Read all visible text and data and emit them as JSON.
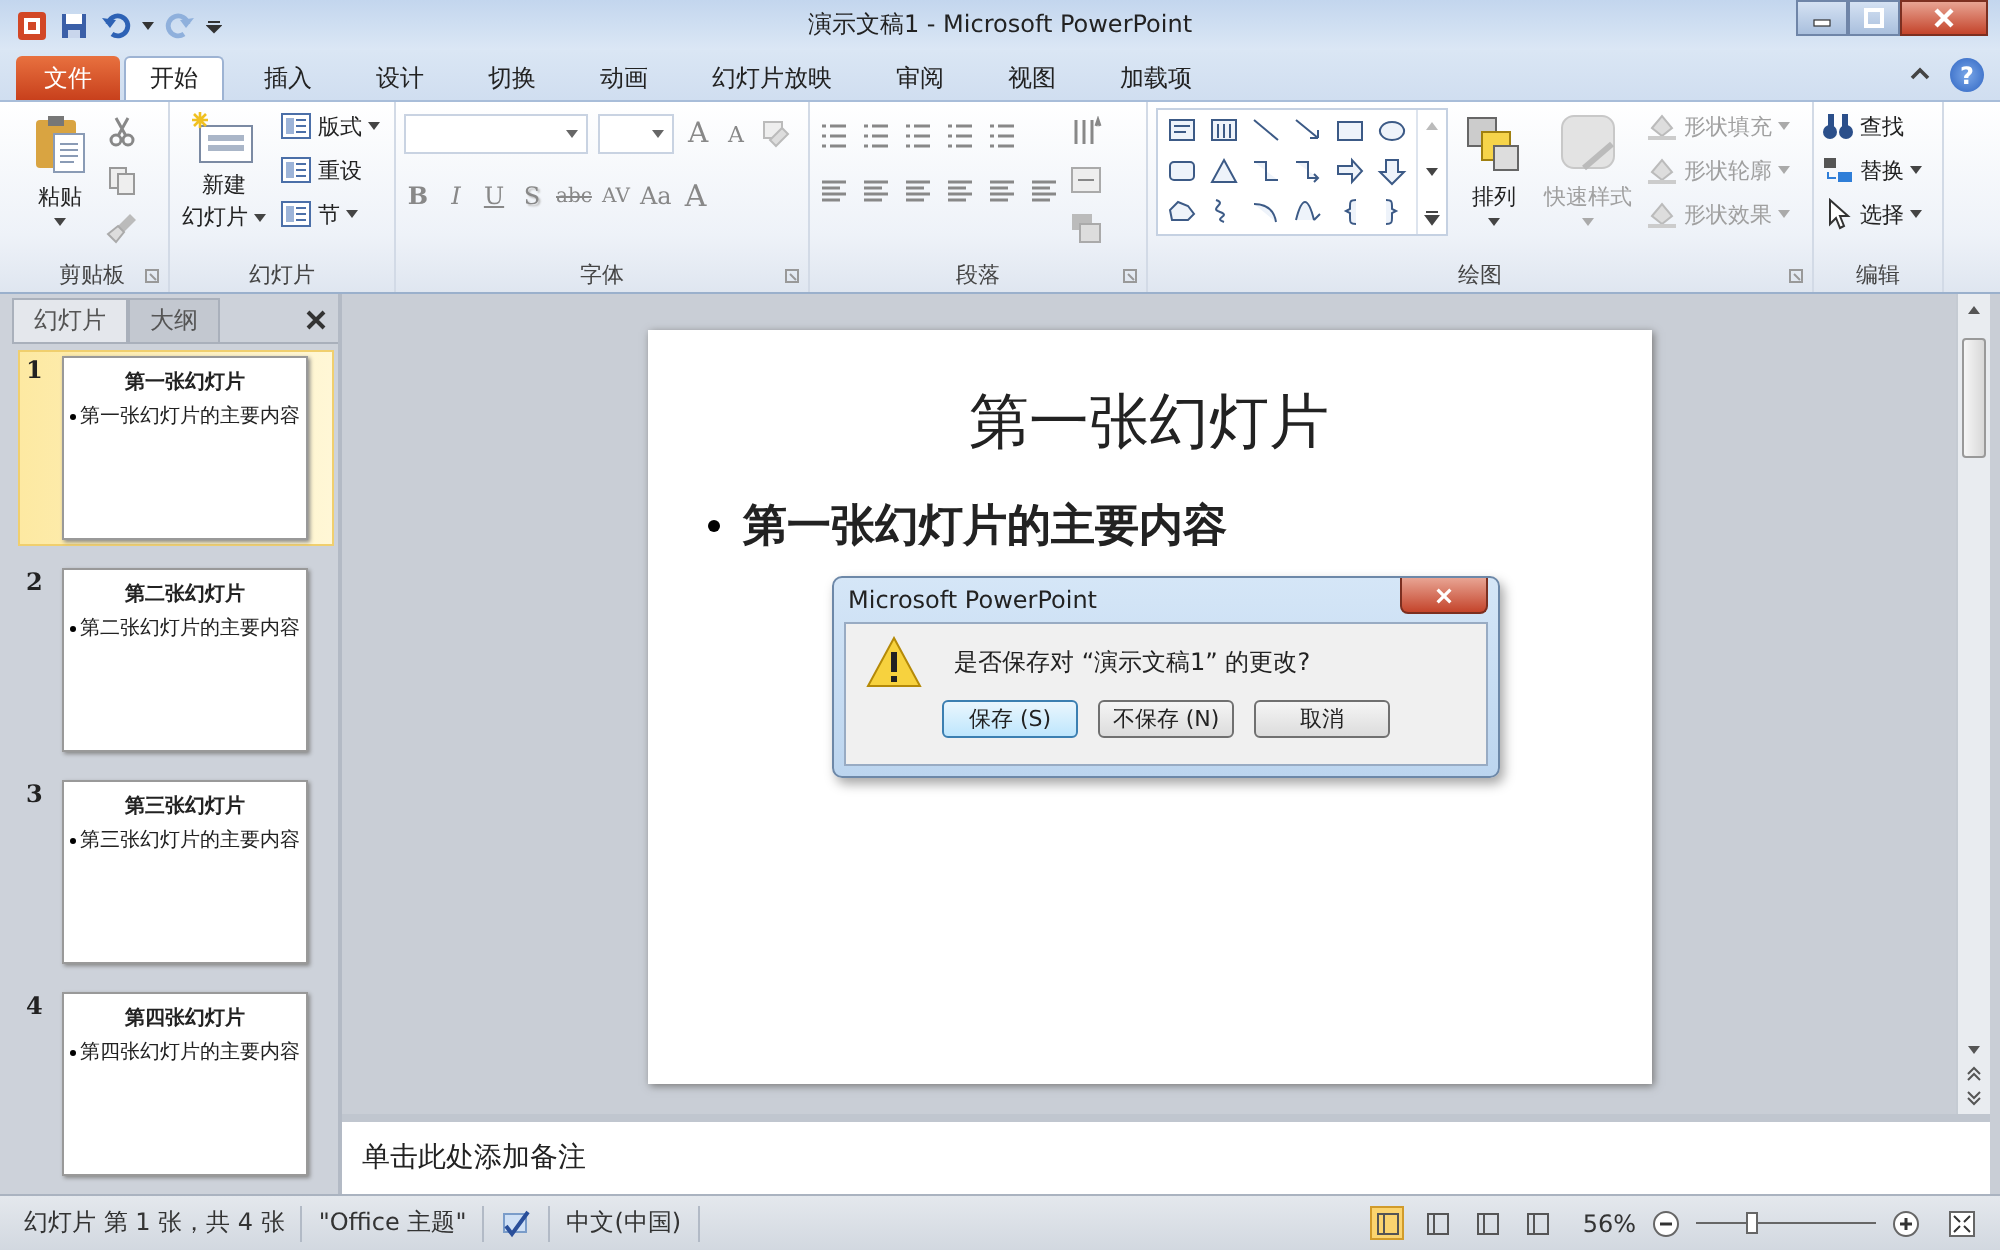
{
  "window": {
    "title": "演示文稿1 - Microsoft PowerPoint"
  },
  "tabs": [
    {
      "label": "文件",
      "kind": "file",
      "selected": false
    },
    {
      "label": "开始",
      "kind": "tab",
      "selected": true
    },
    {
      "label": "插入",
      "kind": "tab",
      "selected": false
    },
    {
      "label": "设计",
      "kind": "tab",
      "selected": false
    },
    {
      "label": "切换",
      "kind": "tab",
      "selected": false
    },
    {
      "label": "动画",
      "kind": "tab",
      "selected": false
    },
    {
      "label": "幻灯片放映",
      "kind": "tab",
      "selected": false
    },
    {
      "label": "审阅",
      "kind": "tab",
      "selected": false
    },
    {
      "label": "视图",
      "kind": "tab",
      "selected": false
    },
    {
      "label": "加载项",
      "kind": "tab",
      "selected": false
    }
  ],
  "help": "?",
  "ribbon": {
    "clipboard": {
      "label": "剪贴板",
      "paste": "粘贴"
    },
    "slides": {
      "label": "幻灯片",
      "new_slide": "新建",
      "new_slide_2": "幻灯片",
      "items": [
        "版式",
        "重设",
        "节"
      ]
    },
    "font": {
      "label": "字体",
      "grow": "A",
      "shrink": "A",
      "buttons": [
        "B",
        "I",
        "U",
        "S",
        "abc",
        "AV",
        "Aa",
        "A"
      ]
    },
    "paragraph": {
      "label": "段落"
    },
    "drawing": {
      "label": "绘图",
      "arrange": "排列",
      "quick_styles": {
        "label": "快速样式",
        "disabled": true
      },
      "shape_items": [
        {
          "label": "形状填充",
          "disabled": true
        },
        {
          "label": "形状轮廓",
          "disabled": true
        },
        {
          "label": "形状效果",
          "disabled": true
        }
      ]
    },
    "editing": {
      "label": "编辑",
      "items": [
        "查找",
        "替换",
        "选择"
      ]
    }
  },
  "panel": {
    "tabs": [
      {
        "label": "幻灯片",
        "selected": true
      },
      {
        "label": "大纲",
        "selected": false
      }
    ]
  },
  "thumbnails": [
    {
      "number": "1",
      "title": "第一张幻灯片",
      "bullet": "第一张幻灯片的主要内容",
      "selected": true
    },
    {
      "number": "2",
      "title": "第二张幻灯片",
      "bullet": "第二张幻灯片的主要内容",
      "selected": false
    },
    {
      "number": "3",
      "title": "第三张幻灯片",
      "bullet": "第三张幻灯片的主要内容",
      "selected": false
    },
    {
      "number": "4",
      "title": "第四张幻灯片",
      "bullet": "第四张幻灯片的主要内容",
      "selected": false
    }
  ],
  "slide": {
    "title": "第一张幻灯片",
    "bullet": "第一张幻灯片的主要内容"
  },
  "dialog": {
    "title": "Microsoft PowerPoint",
    "message": "是否保存对 “演示文稿1” 的更改?",
    "buttons": [
      {
        "label": "保存 (S)",
        "default": true
      },
      {
        "label": "不保存 (N)",
        "default": false
      },
      {
        "label": "取消",
        "default": false
      }
    ]
  },
  "notes": {
    "placeholder": "单击此处添加备注"
  },
  "status_bar": {
    "slide_info": "幻灯片 第 1 张，共 4 张",
    "theme": "\"Office 主题\"",
    "language": "中文(中国)",
    "views": [
      {
        "selected": true
      },
      {
        "selected": false
      },
      {
        "selected": false
      },
      {
        "selected": false
      }
    ],
    "zoom": "56%",
    "zoom_slider": {
      "level": 0.31
    }
  }
}
